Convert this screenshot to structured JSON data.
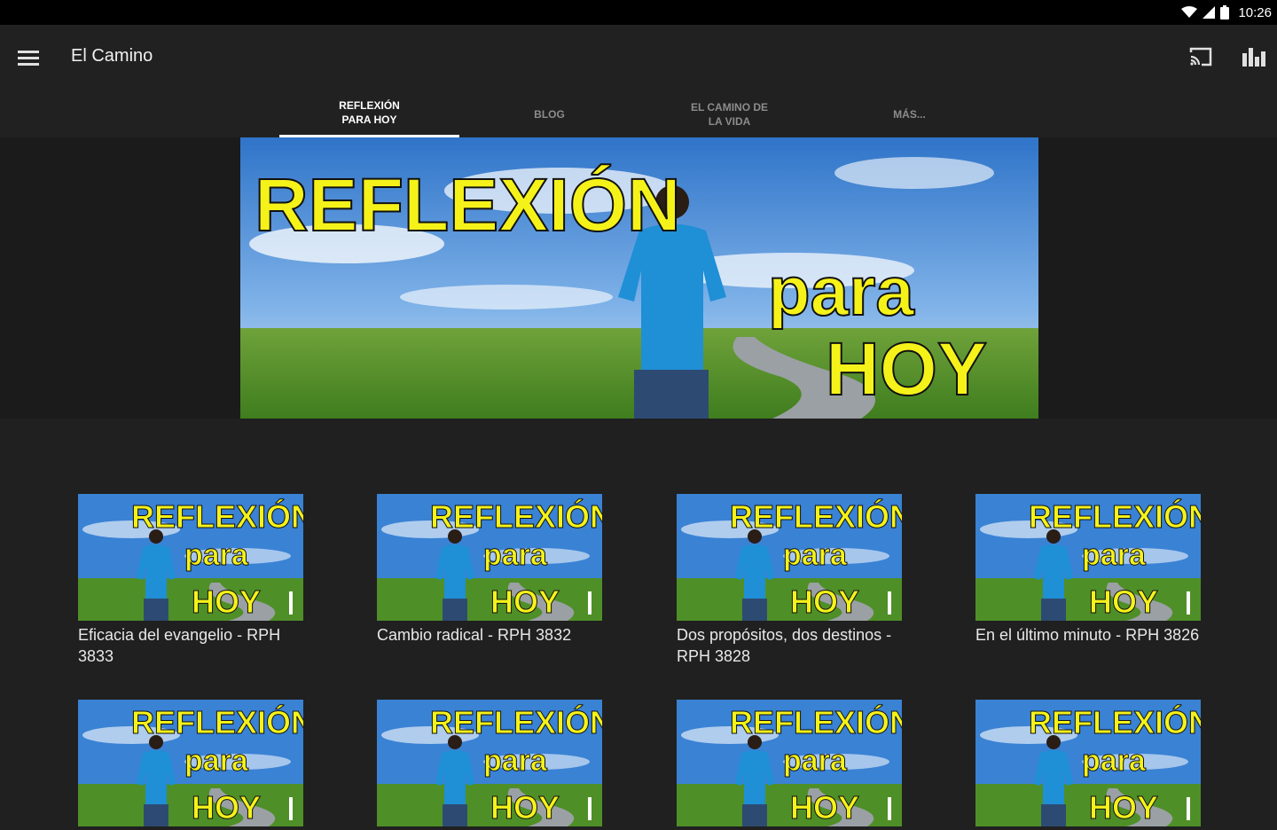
{
  "status_bar": {
    "time": "10:26",
    "icons": [
      "wifi-icon",
      "signal-icon",
      "battery-icon"
    ]
  },
  "toolbar": {
    "title": "El Camino",
    "menu_icon": "hamburger-menu-icon",
    "actions": [
      "cast-icon",
      "bar-chart-icon"
    ]
  },
  "tabs": [
    {
      "label": "REFLEXIÓN PARA HOY",
      "active": true
    },
    {
      "label": "BLOG",
      "active": false
    },
    {
      "label": "EL CAMINO DE LA VIDA",
      "active": false
    },
    {
      "label": "MÁS...",
      "active": false
    }
  ],
  "banner": {
    "title_line1": "REFLEXIÓN",
    "title_line2": "para",
    "title_line3": "HOY"
  },
  "videos": [
    {
      "title": "Eficacia del evangelio - RPH 3833",
      "thumb_line1": "REFLEXIÓN",
      "thumb_line2": "para",
      "thumb_line3": "HOY"
    },
    {
      "title": "Cambio radical - RPH 3832",
      "thumb_line1": "REFLEXIÓN",
      "thumb_line2": "para",
      "thumb_line3": "HOY"
    },
    {
      "title": "Dos propósitos, dos destinos - RPH 3828",
      "thumb_line1": "REFLEXIÓN",
      "thumb_line2": "para",
      "thumb_line3": "HOY"
    },
    {
      "title": "En el último minuto - RPH 3826",
      "thumb_line1": "REFLEXIÓN",
      "thumb_line2": "para",
      "thumb_line3": "HOY"
    },
    {
      "title": "",
      "thumb_line1": "REFLEXIÓN",
      "thumb_line2": "para",
      "thumb_line3": "HOY"
    },
    {
      "title": "",
      "thumb_line1": "REFLEXIÓN",
      "thumb_line2": "para",
      "thumb_line3": "HOY"
    },
    {
      "title": "",
      "thumb_line1": "REFLEXIÓN",
      "thumb_line2": "para",
      "thumb_line3": "HOY"
    },
    {
      "title": "",
      "thumb_line1": "REFLEXIÓN",
      "thumb_line2": "para",
      "thumb_line3": "HOY"
    }
  ],
  "colors": {
    "background": "#202020",
    "toolbar": "#212121",
    "title_yellow": "#f5f21a",
    "sky": "#4a8fd9",
    "grass": "#5a9a2e"
  }
}
